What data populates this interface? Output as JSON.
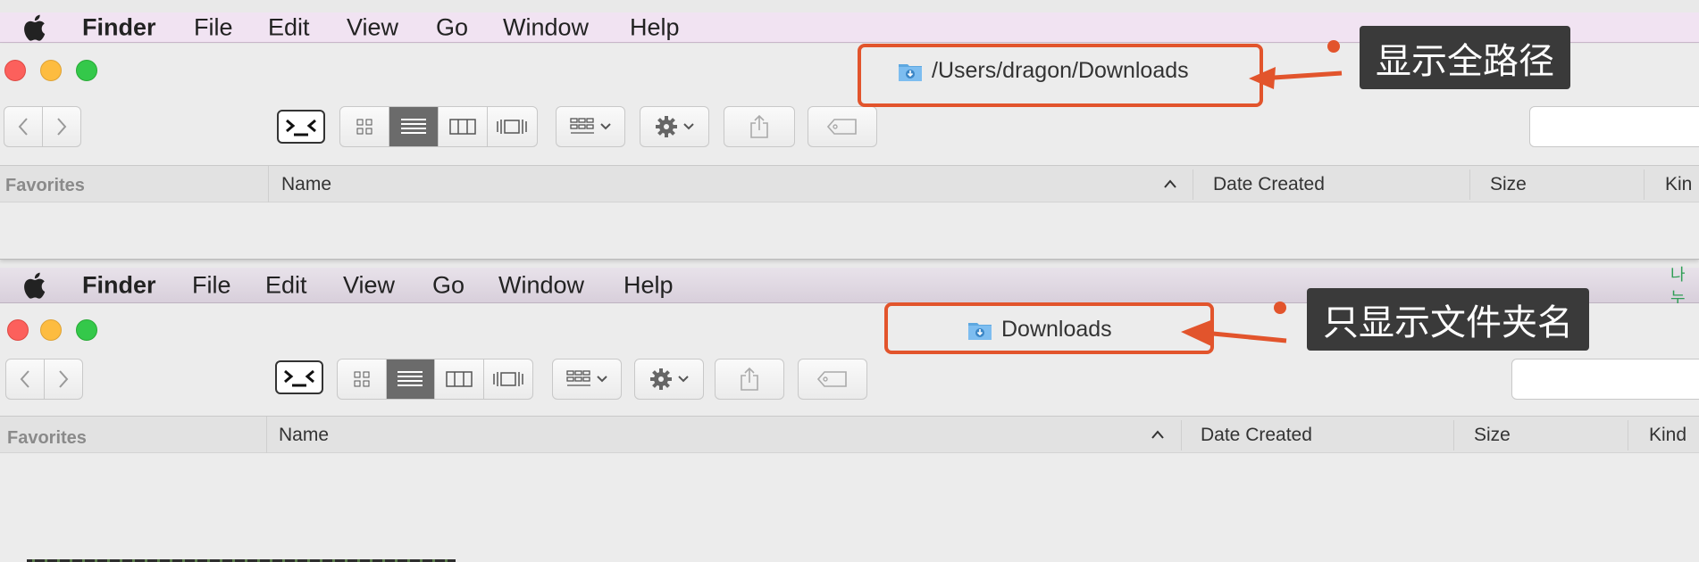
{
  "top": {
    "menu": {
      "app": "Finder",
      "items": [
        "File",
        "Edit",
        "View",
        "Go",
        "Window",
        "Help"
      ]
    },
    "window": {
      "title_path": "/Users/dragon/Downloads",
      "sidebar_heading": "Favorites",
      "columns": {
        "name": "Name",
        "date": "Date Created",
        "size": "Size",
        "kind": "Kin"
      }
    },
    "annotation": "显示全路径"
  },
  "bottom": {
    "menu": {
      "app": "Finder",
      "items": [
        "File",
        "Edit",
        "View",
        "Go",
        "Window",
        "Help"
      ]
    },
    "menu_extra": "나누",
    "window": {
      "title_path": "Downloads",
      "sidebar_heading": "Favorites",
      "columns": {
        "name": "Name",
        "date": "Date Created",
        "size": "Size",
        "kind": "Kind"
      }
    },
    "annotation": "只显示文件夹名"
  },
  "colors": {
    "accent": "#e2542c",
    "label_bg": "#3a3a3a",
    "close": "#fc605c",
    "minimize": "#fdbc40",
    "zoom": "#34c84a"
  },
  "icons": [
    "apple-icon",
    "terminal-icon",
    "icon-view-icon",
    "list-view-icon",
    "column-view-icon",
    "coverflow-view-icon",
    "arrange-icon",
    "gear-icon",
    "share-icon",
    "tag-icon",
    "downloads-folder-icon"
  ]
}
